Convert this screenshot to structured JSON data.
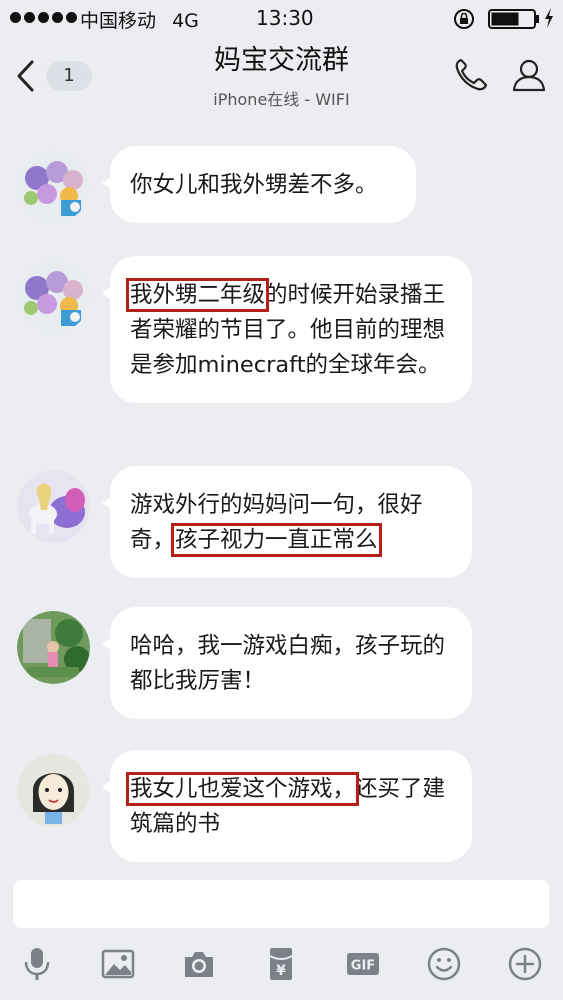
{
  "status_bar": {
    "carrier": "中国移动",
    "network": "4G",
    "time": "13:30"
  },
  "nav": {
    "back_badge": "1",
    "title": "妈宝交流群",
    "subtitle": "iPhone在线 - WIFI"
  },
  "colors": {
    "background": "#ecedf1",
    "bubble": "#ffffff",
    "highlight_box": "#b3211a"
  },
  "messages": [
    {
      "avatar_icon": "flower-bouquet-avatar",
      "segments": [
        {
          "text": "你女儿和我外甥差不多。",
          "highlight": false
        }
      ]
    },
    {
      "avatar_icon": "flower-bouquet-avatar",
      "segments": [
        {
          "text": "我外甥二年级",
          "highlight": true
        },
        {
          "text": "的时候开始录播王者荣耀的节目了。他目前的理想是参加minecraft的全球年会。",
          "highlight": false
        }
      ]
    },
    {
      "avatar_icon": "fantasy-unicorn-avatar",
      "segments": [
        {
          "text": "游戏外行的妈妈问一句，很好奇，",
          "highlight": false
        },
        {
          "text": "孩子视力一直正常么",
          "highlight": true
        }
      ]
    },
    {
      "avatar_icon": "garden-photo-avatar",
      "segments": [
        {
          "text": "哈哈，我一游戏白痴，孩子玩的都比我厉害！",
          "highlight": false
        }
      ]
    },
    {
      "avatar_icon": "girl-drawing-avatar",
      "segments": [
        {
          "text": "我女儿也爱这个游戏，",
          "highlight": true
        },
        {
          "text": "还买了建筑篇的书",
          "highlight": false
        }
      ]
    }
  ],
  "input": {
    "placeholder": "",
    "value": ""
  },
  "toolbar": {
    "items": [
      "mic-icon",
      "image-icon",
      "camera-icon",
      "red-packet-icon",
      "gif-icon",
      "emoji-icon",
      "plus-icon"
    ],
    "gif_label": "GIF",
    "red_packet_symbol": "¥"
  }
}
